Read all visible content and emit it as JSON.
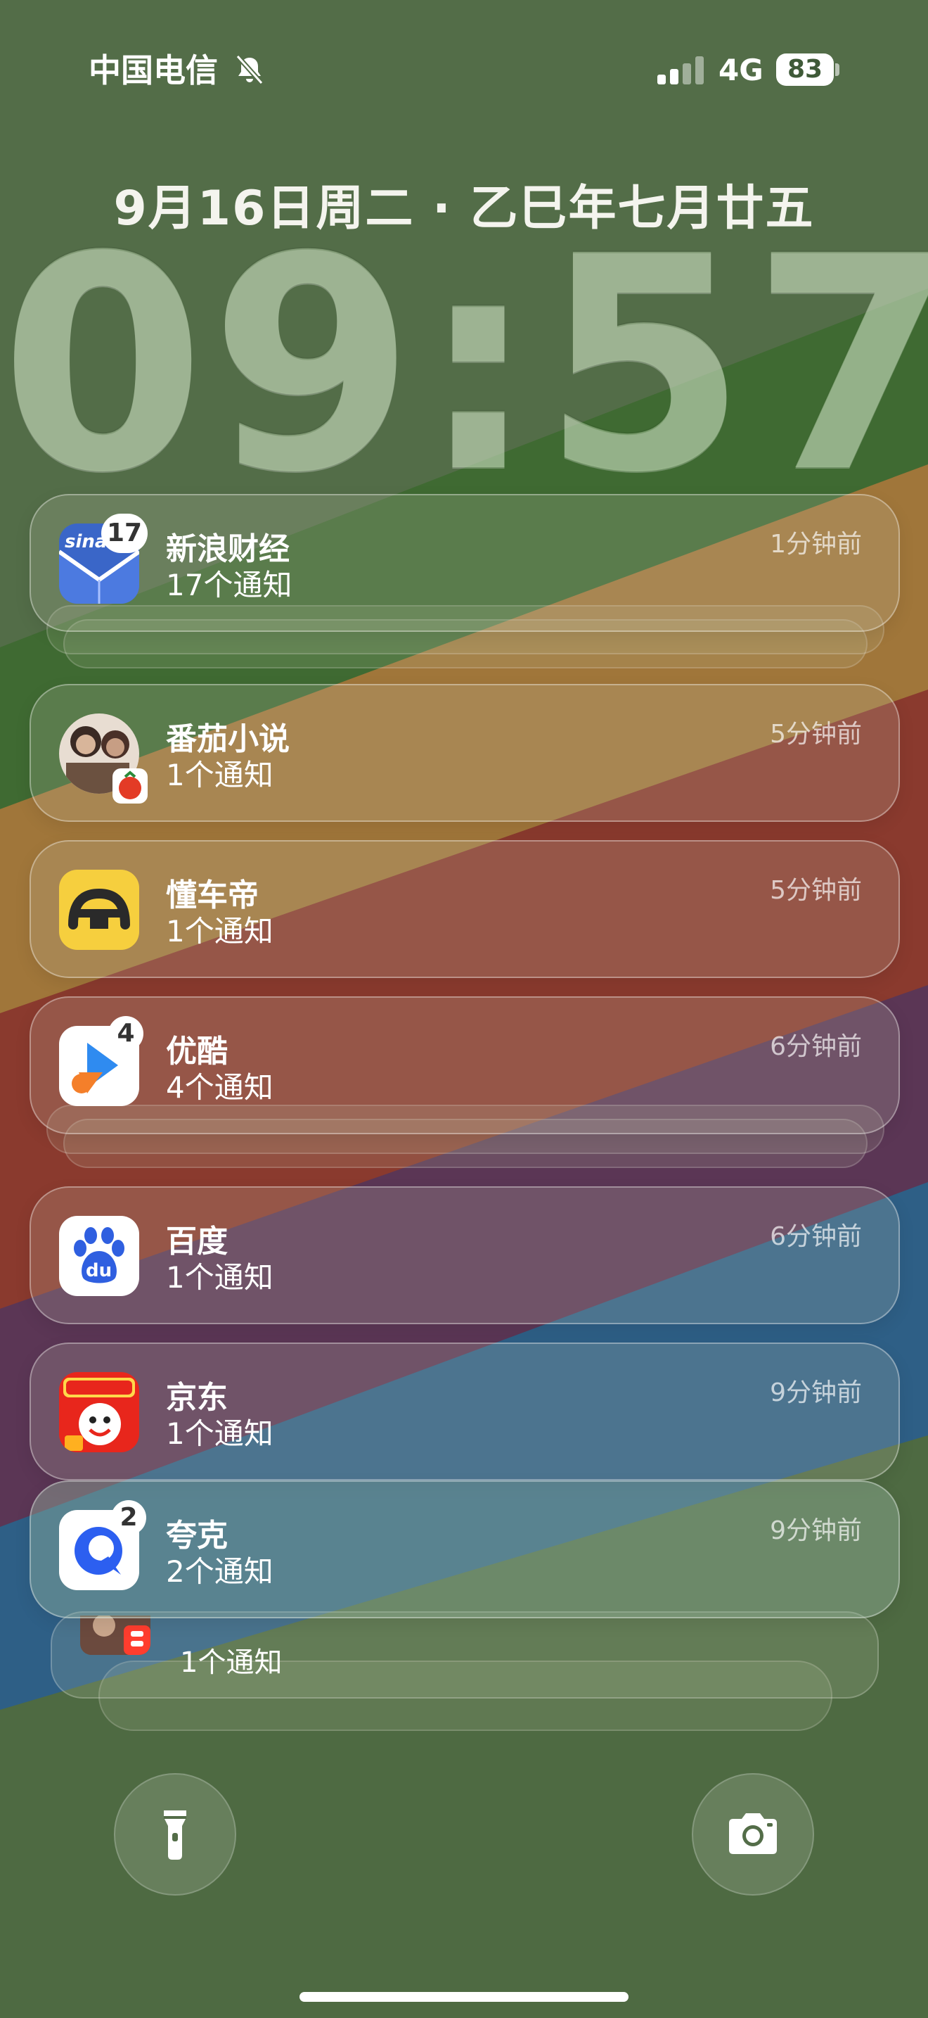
{
  "status_bar": {
    "carrier": "中国电信",
    "network": "4G",
    "battery": "83",
    "silent_icon": "bell-slash-icon",
    "signal_icon": "cellular-signal-icon"
  },
  "lock_screen": {
    "date": "9月16日周二 · 乙巳年七月廿五",
    "time": "09:57"
  },
  "notifications": [
    {
      "app": "新浪财经",
      "count_text": "17个通知",
      "time": "1分钟前",
      "badge": "17",
      "icon": "sina-finance-icon",
      "color": "#3a66c8"
    },
    {
      "app": "番茄小说",
      "count_text": "1个通知",
      "time": "5分钟前",
      "badge": "",
      "icon": "fanqie-novel-icon",
      "color": "#e54b2c"
    },
    {
      "app": "懂车帝",
      "count_text": "1个通知",
      "time": "5分钟前",
      "badge": "",
      "icon": "dongchedi-icon",
      "color": "#f6cf3e"
    },
    {
      "app": "优酷",
      "count_text": "4个通知",
      "time": "6分钟前",
      "badge": "4",
      "icon": "youku-icon",
      "color": "#2f8bf0"
    },
    {
      "app": "百度",
      "count_text": "1个通知",
      "time": "6分钟前",
      "badge": "",
      "icon": "baidu-icon",
      "color": "#2f5fe0"
    },
    {
      "app": "京东",
      "count_text": "1个通知",
      "time": "9分钟前",
      "badge": "",
      "icon": "jd-icon",
      "color": "#e8261c"
    },
    {
      "app": "夸克",
      "count_text": "2个通知",
      "time": "9分钟前",
      "badge": "2",
      "icon": "quark-icon",
      "color": "#2c5ff0"
    }
  ],
  "stacked_preview": {
    "count_text": "1个通知",
    "icon": "xiaohongshu-icon"
  },
  "controls": {
    "flashlight_icon": "flashlight-icon",
    "camera_icon": "camera-icon"
  }
}
